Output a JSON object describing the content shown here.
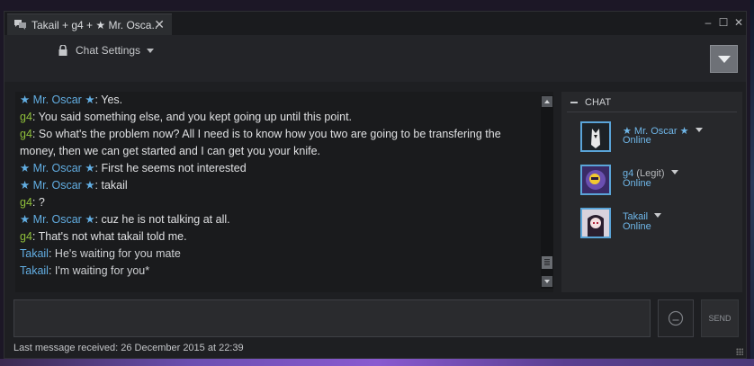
{
  "tab": {
    "title": "Takail + g4 + ★ Mr. Osca...",
    "close": "✕"
  },
  "window_controls": {
    "minimize": "–",
    "maximize": "☐",
    "close": "✕"
  },
  "header": {
    "settings_label": "Chat Settings"
  },
  "messages": [
    {
      "sender": "★ Mr. Oscar ★",
      "sender_color": "oscar",
      "text": ": Yes."
    },
    {
      "sender": "g4",
      "sender_color": "g4",
      "text": ": You said something else, and you kept going up until this point."
    },
    {
      "sender": "g4",
      "sender_color": "g4",
      "text": ": So what's the problem now? All I need is to know how you two are going to be transfering the money, then we can get started and I can get you your knife."
    },
    {
      "sender": "★ Mr. Oscar ★",
      "sender_color": "oscar",
      "text": ": First he seems not interested"
    },
    {
      "sender": "★ Mr. Oscar ★",
      "sender_color": "oscar",
      "text": ": takail"
    },
    {
      "sender": "g4",
      "sender_color": "g4",
      "text": ": ?"
    },
    {
      "sender": "★ Mr. Oscar ★",
      "sender_color": "oscar",
      "text": ": cuz he is not talking at all."
    },
    {
      "sender": "g4",
      "sender_color": "g4",
      "text": ": That's not what takail told me."
    },
    {
      "sender": "Takail",
      "sender_color": "takail",
      "text": ": He's waiting for you mate"
    },
    {
      "sender": "Takail",
      "sender_color": "takail",
      "text": ": I'm waiting for you*"
    }
  ],
  "friends": {
    "header": "CHAT",
    "members": [
      {
        "name": "★ Mr. Oscar ★",
        "nickname": "",
        "status": "Online"
      },
      {
        "name": "g4",
        "nickname": " (Legit)",
        "status": "Online"
      },
      {
        "name": "Takail",
        "nickname": "",
        "status": "Online"
      }
    ]
  },
  "composer": {
    "send_label": "SEND"
  },
  "footer": {
    "last_message": "Last message received: 26 December 2015 at 22:39"
  },
  "colors": {
    "oscar": "#62aee3",
    "g4": "#8fbf3a",
    "takail": "#62aee3",
    "online": "#6fb6e8"
  }
}
